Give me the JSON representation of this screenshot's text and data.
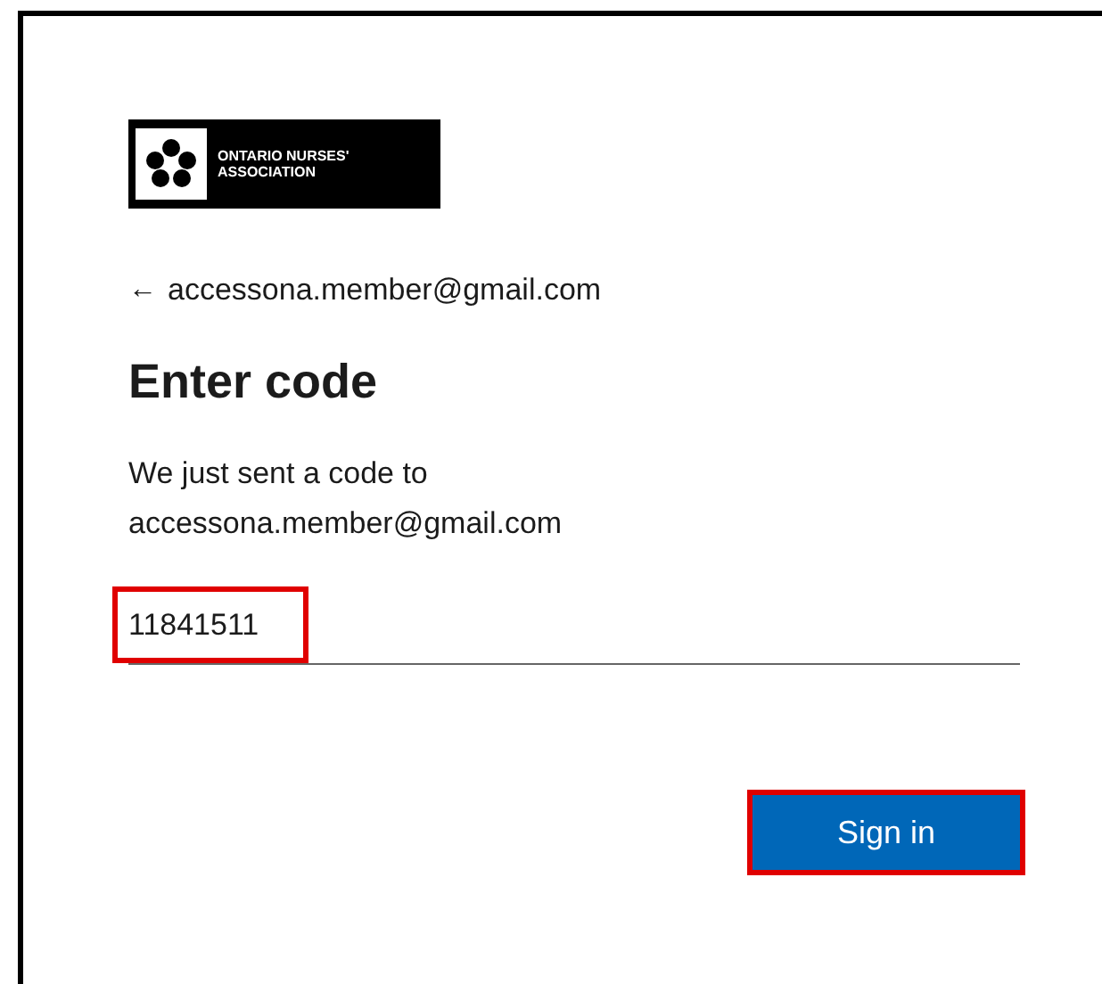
{
  "logo": {
    "text": "ONTARIO NURSES' ASSOCIATION"
  },
  "back": {
    "arrow": "←",
    "email": "accessona.member@gmail.com"
  },
  "title": "Enter code",
  "description": [
    "We just sent a code to",
    "accessona.member@gmail.com"
  ],
  "code_field": {
    "value": "11841511",
    "highlighted": true
  },
  "sign_in_button": {
    "label": "Sign in",
    "highlighted": true
  }
}
